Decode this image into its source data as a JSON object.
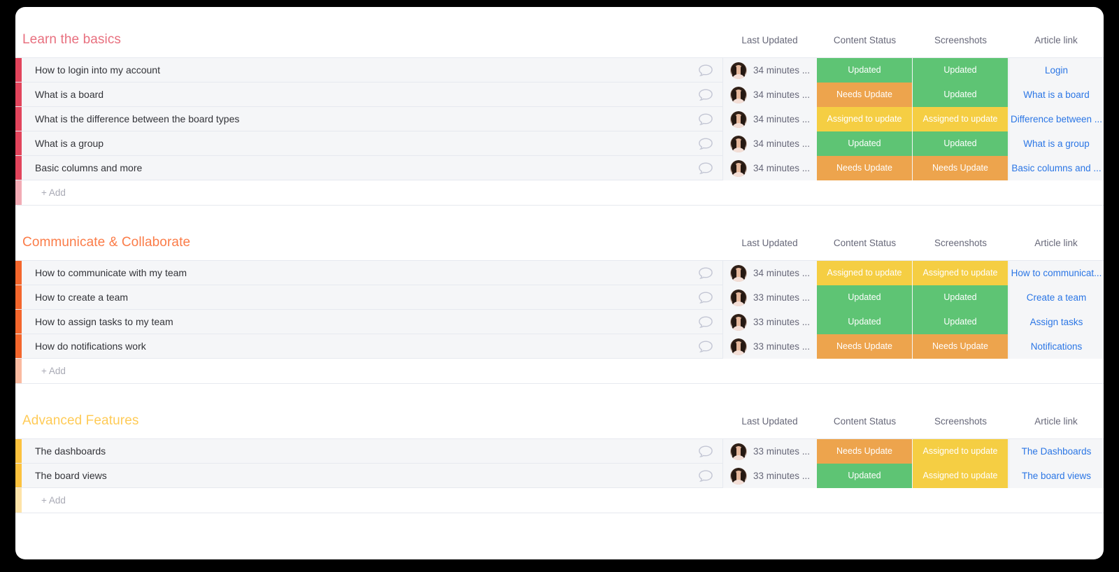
{
  "columns": {
    "last_updated": "Last Updated",
    "content_status": "Content Status",
    "screenshots": "Screenshots",
    "article_link": "Article link"
  },
  "add_label": "+ Add",
  "icons": {
    "comment": "comment-bubble-icon",
    "avatar": "user-avatar-icon"
  },
  "colors": {
    "green": "#5ec474",
    "orange": "#eda44d",
    "yellow": "#f5ce43",
    "red": "#e2445c",
    "red_title": "#e8707f",
    "orange_bar": "#f4662c",
    "orange_title": "#fb7c48",
    "yellow_bar": "#fcc23e",
    "yellow_title": "#ffcb57",
    "link": "#2b76e5",
    "row_bg": "#f5f6f8",
    "text": "#323338",
    "muted": "#676879"
  },
  "groups": [
    {
      "title": "Learn the basics",
      "title_color": "#e8707f",
      "bar_color": "#e2445c",
      "rows": [
        {
          "name": "How to login into my account",
          "time": "34 minutes ...",
          "content_status": {
            "label": "Updated",
            "color": "#5ec474"
          },
          "screenshots": {
            "label": "Updated",
            "color": "#5ec474"
          },
          "link": "Login"
        },
        {
          "name": "What is a board",
          "time": "34 minutes ...",
          "content_status": {
            "label": "Needs Update",
            "color": "#eda44d"
          },
          "screenshots": {
            "label": "Updated",
            "color": "#5ec474"
          },
          "link": "What is a board"
        },
        {
          "name": "What is the difference between the board types",
          "time": "34 minutes ...",
          "content_status": {
            "label": "Assigned to update",
            "color": "#f5ce43"
          },
          "screenshots": {
            "label": "Assigned to update",
            "color": "#f5ce43"
          },
          "link": "Difference between ..."
        },
        {
          "name": "What is a group",
          "time": "34 minutes ...",
          "content_status": {
            "label": "Updated",
            "color": "#5ec474"
          },
          "screenshots": {
            "label": "Updated",
            "color": "#5ec474"
          },
          "link": "What is a group"
        },
        {
          "name": "Basic columns and more",
          "time": "34 minutes ...",
          "content_status": {
            "label": "Needs Update",
            "color": "#eda44d"
          },
          "screenshots": {
            "label": "Needs Update",
            "color": "#eda44d"
          },
          "link": "Basic columns and ..."
        }
      ]
    },
    {
      "title": "Communicate & Collaborate",
      "title_color": "#fb7c48",
      "bar_color": "#f4662c",
      "rows": [
        {
          "name": "How to communicate with my team",
          "time": "34 minutes ...",
          "content_status": {
            "label": "Assigned to update",
            "color": "#f5ce43"
          },
          "screenshots": {
            "label": "Assigned to update",
            "color": "#f5ce43"
          },
          "link": "How to communicat..."
        },
        {
          "name": "How to create a team",
          "time": "33 minutes ...",
          "content_status": {
            "label": "Updated",
            "color": "#5ec474"
          },
          "screenshots": {
            "label": "Updated",
            "color": "#5ec474"
          },
          "link": "Create a team"
        },
        {
          "name": "How to assign tasks to my team",
          "time": "33 minutes ...",
          "content_status": {
            "label": "Updated",
            "color": "#5ec474"
          },
          "screenshots": {
            "label": "Updated",
            "color": "#5ec474"
          },
          "link": "Assign tasks"
        },
        {
          "name": "How do notifications work",
          "time": "33 minutes ...",
          "content_status": {
            "label": "Needs Update",
            "color": "#eda44d"
          },
          "screenshots": {
            "label": "Needs Update",
            "color": "#eda44d"
          },
          "link": "Notifications"
        }
      ]
    },
    {
      "title": "Advanced Features",
      "title_color": "#ffcb57",
      "bar_color": "#fcc23e",
      "rows": [
        {
          "name": "The dashboards",
          "time": "33 minutes ...",
          "content_status": {
            "label": "Needs Update",
            "color": "#eda44d"
          },
          "screenshots": {
            "label": "Assigned to update",
            "color": "#f5ce43"
          },
          "link": "The Dashboards"
        },
        {
          "name": "The board views",
          "time": "33 minutes ...",
          "content_status": {
            "label": "Updated",
            "color": "#5ec474"
          },
          "screenshots": {
            "label": "Assigned to update",
            "color": "#f5ce43"
          },
          "link": "The board views"
        }
      ]
    }
  ]
}
